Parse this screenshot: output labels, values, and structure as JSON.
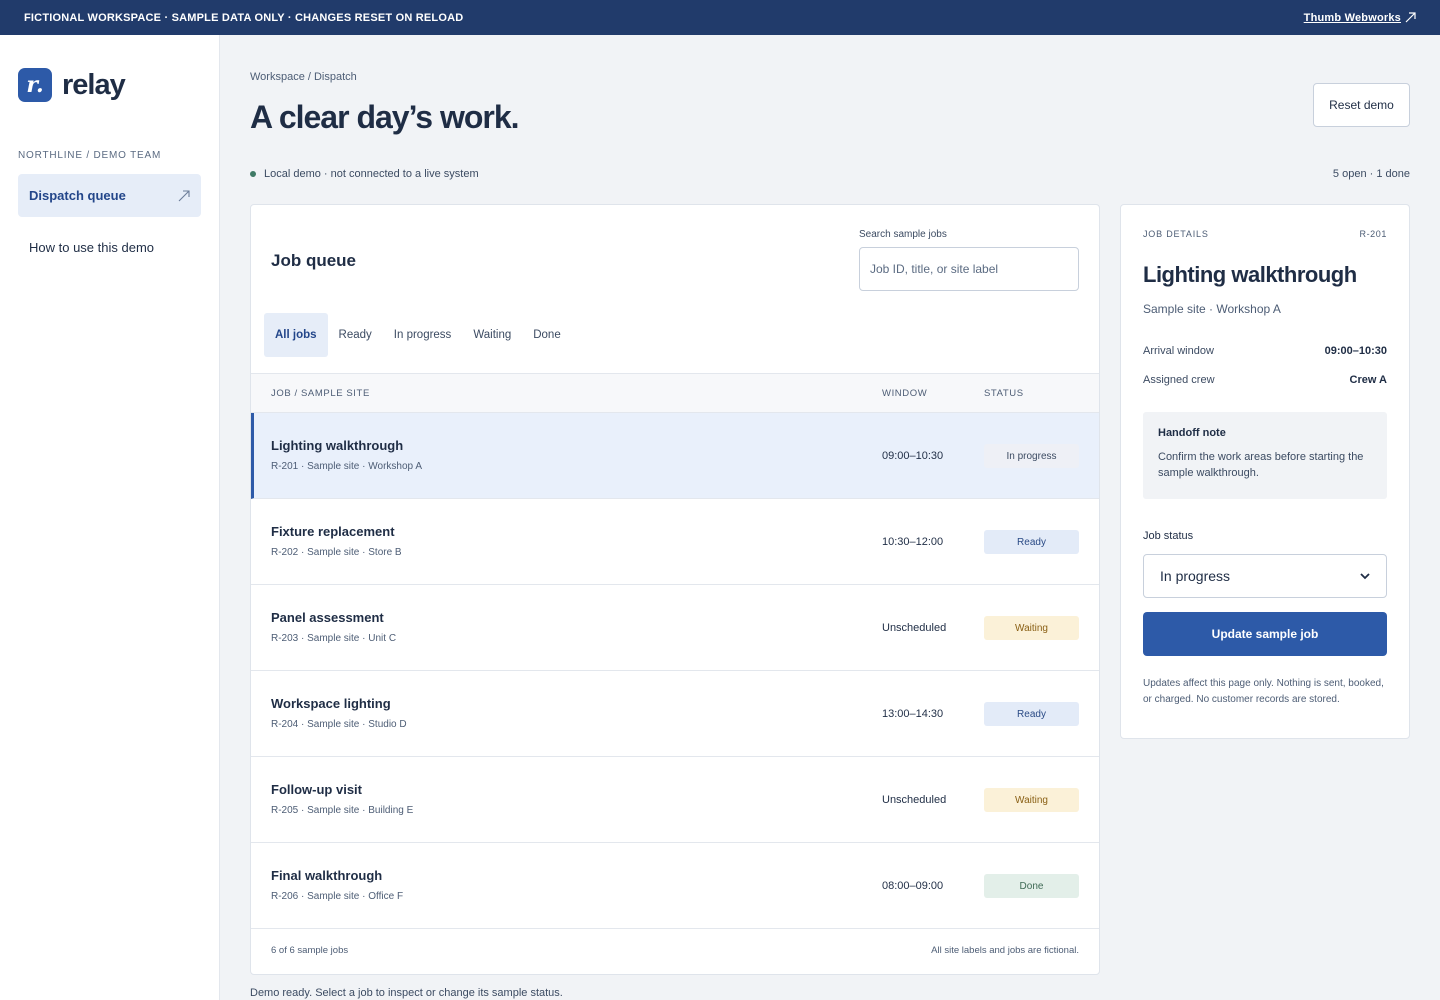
{
  "banner": {
    "notice": "FICTIONAL WORKSPACE · SAMPLE DATA ONLY · CHANGES RESET ON RELOAD",
    "credit": "Thumb Webworks"
  },
  "sidebar": {
    "logo_letter": "r.",
    "logo_text": "relay",
    "team": "NORTHLINE / DEMO TEAM",
    "items": [
      {
        "label": "Dispatch queue",
        "active": true
      },
      {
        "label": "How to use this demo",
        "active": false
      }
    ]
  },
  "header": {
    "breadcrumb": "Workspace / Dispatch",
    "title": "A clear day’s work.",
    "reset_label": "Reset demo",
    "status": "Local demo · not connected to a live system",
    "counts": "5 open · 1 done"
  },
  "queue": {
    "title": "Job queue",
    "search_label": "Search sample jobs",
    "search_placeholder": "Job ID, title, or site label",
    "search_value": "",
    "tabs": [
      "All jobs",
      "Ready",
      "In progress",
      "Waiting",
      "Done"
    ],
    "active_tab": "All jobs",
    "columns": [
      "JOB / SAMPLE SITE",
      "WINDOW",
      "STATUS"
    ],
    "rows": [
      {
        "title": "Lighting walkthrough",
        "sub": "R-201 · Sample site · Workshop A",
        "window": "09:00–10:30",
        "status": "In progress",
        "selected": true
      },
      {
        "title": "Fixture replacement",
        "sub": "R-202 · Sample site · Store B",
        "window": "10:30–12:00",
        "status": "Ready",
        "selected": false
      },
      {
        "title": "Panel assessment",
        "sub": "R-203 · Sample site · Unit C",
        "window": "Unscheduled",
        "status": "Waiting",
        "selected": false
      },
      {
        "title": "Workspace lighting",
        "sub": "R-204 · Sample site · Studio D",
        "window": "13:00–14:30",
        "status": "Ready",
        "selected": false
      },
      {
        "title": "Follow-up visit",
        "sub": "R-205 · Sample site · Building E",
        "window": "Unscheduled",
        "status": "Waiting",
        "selected": false
      },
      {
        "title": "Final walkthrough",
        "sub": "R-206 · Sample site · Office F",
        "window": "08:00–09:00",
        "status": "Done",
        "selected": false
      }
    ],
    "footer_count": "6 of 6 sample jobs",
    "footer_note": "All site labels and jobs are fictional."
  },
  "status_message": "Demo ready. Select a job to inspect or change its sample status.",
  "details": {
    "label": "JOB DETAILS",
    "id": "R-201",
    "title": "Lighting walkthrough",
    "sub": "Sample site · Workshop A",
    "arrival_label": "Arrival window",
    "arrival_value": "09:00–10:30",
    "crew_label": "Assigned crew",
    "crew_value": "Crew A",
    "note_title": "Handoff note",
    "note_body": "Confirm the work areas before starting the sample walkthrough.",
    "status_label": "Job status",
    "status_value": "In progress",
    "update_label": "Update sample job",
    "footer": "Updates affect this page only. Nothing is sent, booked, or charged. No customer records are stored."
  },
  "colors": {
    "banner": "#213b6b",
    "accent": "#2d5aa8",
    "ready": "#e3ebf8",
    "waiting": "#fbf1d8",
    "done": "#e3efe9"
  }
}
